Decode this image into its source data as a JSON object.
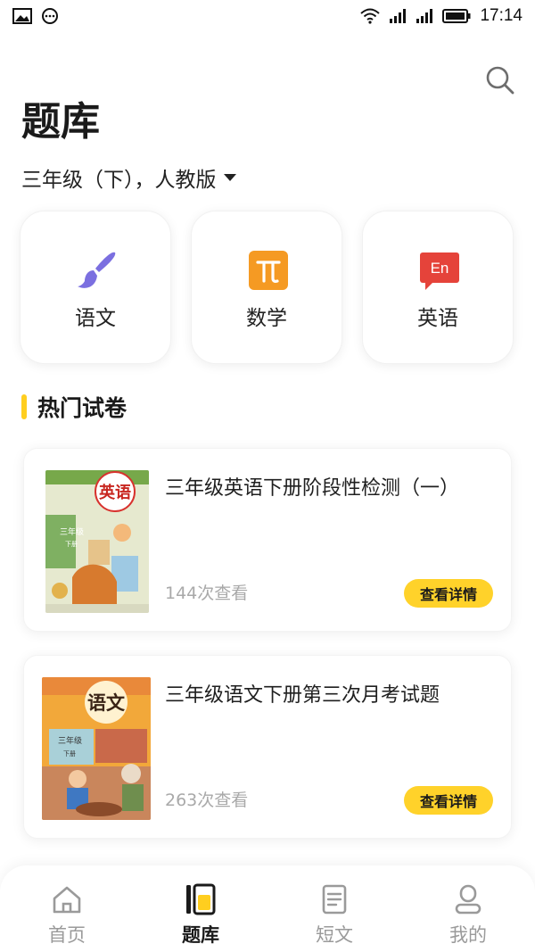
{
  "status_bar": {
    "time": "17:14"
  },
  "header": {
    "title": "题库",
    "grade": "三年级（下），人教版"
  },
  "subjects": [
    {
      "label": "语文",
      "icon": "brush-icon",
      "color": "#7b6fe0"
    },
    {
      "label": "数学",
      "icon": "pi-icon",
      "color": "#f59a23"
    },
    {
      "label": "英语",
      "icon": "en-chat-icon",
      "color": "#e5433a"
    }
  ],
  "section": {
    "title": "热门试卷",
    "accent": "#ffce1f"
  },
  "papers": [
    {
      "title": "三年级英语下册阶段性检测（一）",
      "views": "144次查看",
      "button": "查看详情",
      "cover_title": "英语",
      "cover_grade": "三年级",
      "cover_sub": "下册"
    },
    {
      "title": "三年级语文下册第三次月考试题",
      "views": "263次查看",
      "button": "查看详情",
      "cover_title": "语文",
      "cover_grade": "三年级",
      "cover_sub": "下册"
    }
  ],
  "tabs": [
    {
      "label": "首页",
      "icon": "home-icon",
      "active": false
    },
    {
      "label": "题库",
      "icon": "question-bank-icon",
      "active": true
    },
    {
      "label": "短文",
      "icon": "document-icon",
      "active": false
    },
    {
      "label": "我的",
      "icon": "profile-icon",
      "active": false
    }
  ],
  "colors": {
    "accent_yellow": "#ffd22a",
    "muted_text": "#a9a9a9"
  }
}
